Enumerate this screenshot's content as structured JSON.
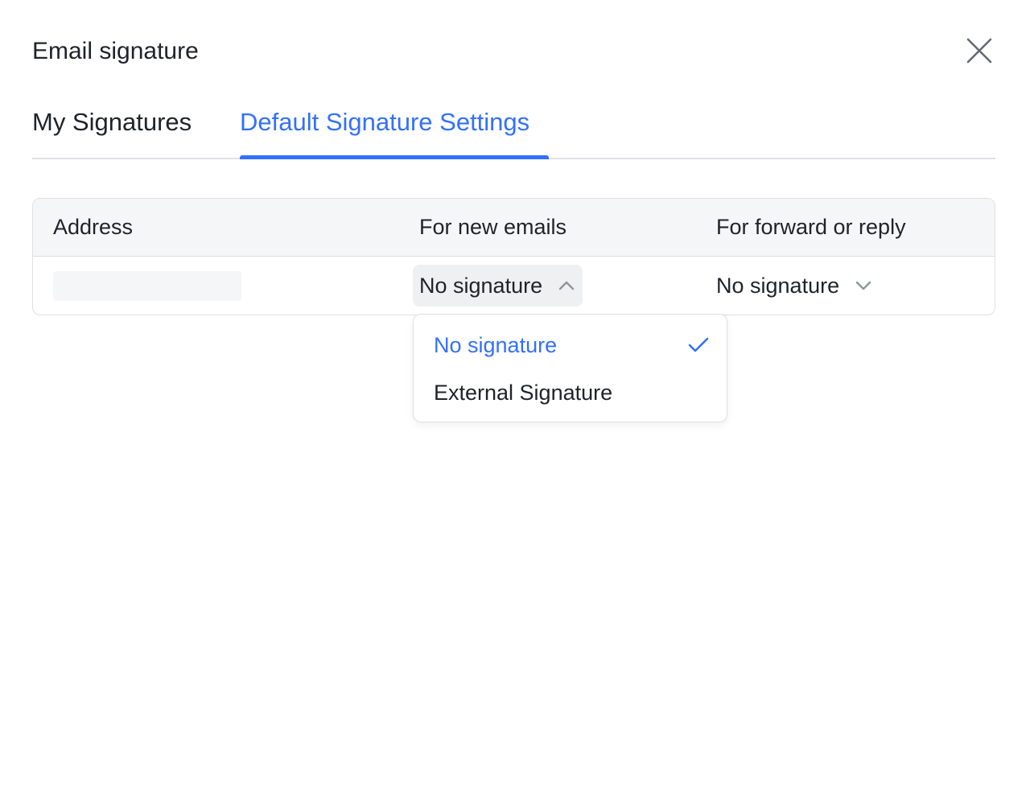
{
  "dialog": {
    "title": "Email signature"
  },
  "tabs": [
    {
      "label": "My Signatures",
      "active": false
    },
    {
      "label": "Default Signature Settings",
      "active": true
    }
  ],
  "table": {
    "headers": {
      "address": "Address",
      "new_emails": "For new emails",
      "forward_reply": "For forward or reply"
    },
    "rows": [
      {
        "address": "",
        "new_emails": "No signature",
        "forward_reply": "No signature"
      }
    ]
  },
  "dropdown": {
    "options": [
      {
        "label": "No signature",
        "selected": true
      },
      {
        "label": "External Signature",
        "selected": false
      }
    ]
  },
  "colors": {
    "accent": "#3370ff",
    "text": "#1f2329",
    "border": "#dee0e3",
    "header_bg": "#f5f6f7"
  },
  "icons": {
    "close": "close-icon",
    "chevron_up": "chevron-up-icon",
    "chevron_down": "chevron-down-icon",
    "check": "check-icon"
  }
}
